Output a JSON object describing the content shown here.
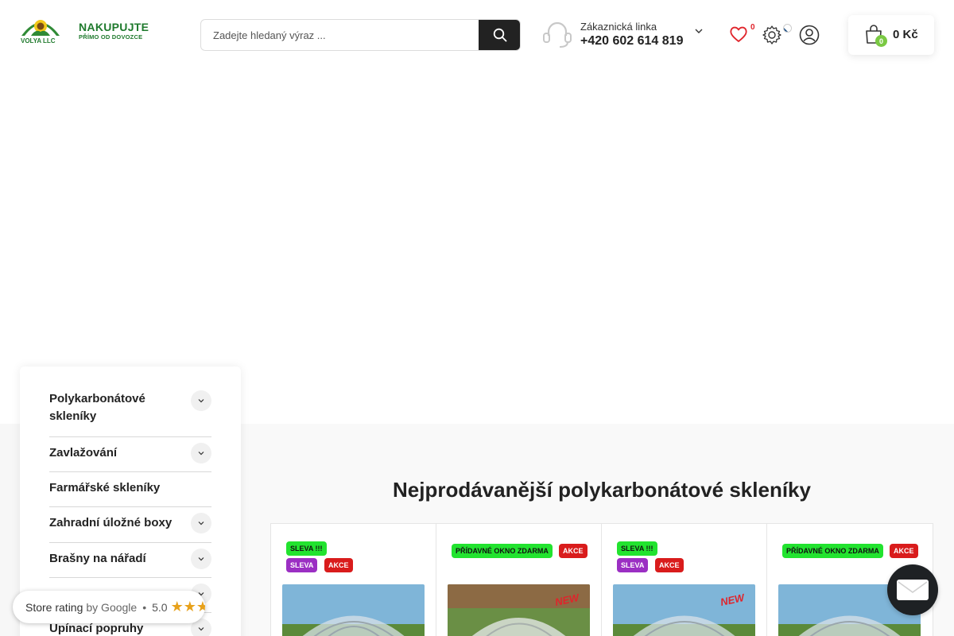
{
  "header": {
    "logo": {
      "brand": "VOLYA LLC",
      "slogan_main": "NAKUPUJTE",
      "slogan_sub": "PŘÍMO OD DOVOZCE"
    },
    "search": {
      "placeholder": "Zadejte hledaný výraz ...",
      "value": ""
    },
    "support": {
      "label": "Zákaznická linka",
      "phone": "+420 602 614 819"
    },
    "wishlist_count": "0",
    "cart": {
      "count": "0",
      "total": "0 Kč"
    }
  },
  "colors": {
    "brand_green": "#1f7a2d",
    "cart_badge": "#7ac943",
    "wishlist_count": "#e0242b",
    "tag_green": "#22e32f",
    "tag_purple": "#9b2fc3",
    "tag_red": "#d91c1c"
  },
  "categories": [
    {
      "label": "Polykarbonátové skleníky",
      "expandable": true
    },
    {
      "label": "Zavlažování",
      "expandable": true
    },
    {
      "label": "Farmářské skleníky",
      "expandable": false
    },
    {
      "label": "Zahradní úložné boxy",
      "expandable": true
    },
    {
      "label": "Brašny na nářadí",
      "expandable": true
    },
    {
      "label": "Upínací popruhy",
      "expandable": true
    }
  ],
  "bestsellers": {
    "title": "Nejprodávanější polykarbonátové skleníky",
    "products": [
      {
        "tags": [
          "SLEVA !!!",
          "SLEVA",
          "AKCE"
        ],
        "new_badge": false
      },
      {
        "tags": [
          "PŘÍDAVNÉ OKNO ZDARMA",
          "AKCE"
        ],
        "new_badge": true,
        "new_label": "NEW"
      },
      {
        "tags": [
          "SLEVA !!!",
          "SLEVA",
          "AKCE"
        ],
        "new_badge": true,
        "new_label": "NEW"
      },
      {
        "tags": [
          "PŘÍDAVNÉ OKNO ZDARMA",
          "AKCE"
        ],
        "new_badge": false
      }
    ]
  },
  "rating_widget": {
    "label": "Store rating",
    "by": "by Google",
    "separator": "•",
    "score": "5.0",
    "stars": "★★★★★"
  },
  "icons": {
    "search": "search-icon",
    "support": "headset-icon",
    "support_toggle": "chevron-down-icon",
    "wishlist": "heart-icon",
    "settings": "gear-icon",
    "language": "czech-flag-icon",
    "account": "user-icon",
    "cart": "shopping-bag-icon",
    "chat": "chat-icon"
  }
}
